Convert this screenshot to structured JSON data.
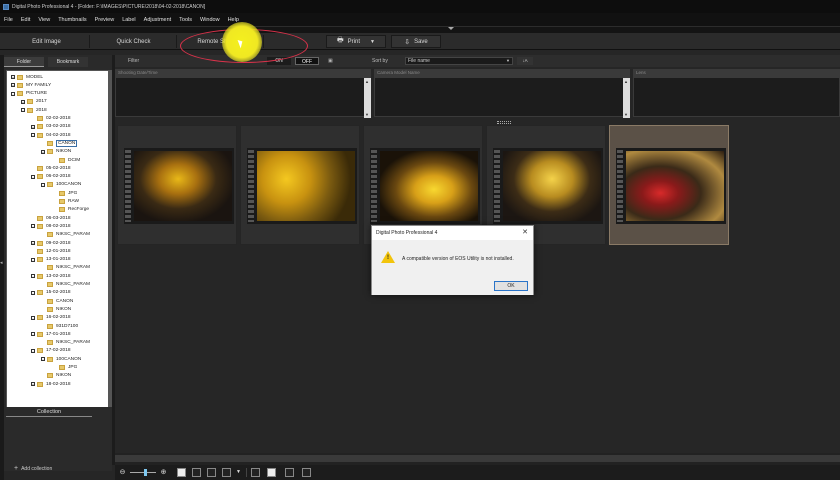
{
  "window": {
    "title": "Digital Photo Professional 4 - [Folder: F:\\IMAGES\\PICTURE\\2018\\04-02-2018\\CANON]"
  },
  "menu": [
    "File",
    "Edit",
    "View",
    "Thumbnails",
    "Preview",
    "Label",
    "Adjustment",
    "Tools",
    "Window",
    "Help"
  ],
  "toolbar": {
    "edit_image": "Edit Image",
    "quick_check": "Quick Check",
    "remote_shooting": "Remote Shooting",
    "print": "Print",
    "save": "Save"
  },
  "left_panel": {
    "tabs": [
      "Folder",
      "Bookmark"
    ],
    "tree": [
      {
        "label": "MODEL",
        "level": 1,
        "expander": "+"
      },
      {
        "label": "MY FAMILY",
        "level": 1,
        "expander": "+"
      },
      {
        "label": "PICTURE",
        "level": 1,
        "expander": "-"
      },
      {
        "label": "2017",
        "level": 2,
        "expander": "+"
      },
      {
        "label": "2018",
        "level": 2,
        "expander": "-"
      },
      {
        "label": "02-02-2018",
        "level": 3,
        "expander": ""
      },
      {
        "label": "03-02-2018",
        "level": 3,
        "expander": "+"
      },
      {
        "label": "04-02-2018",
        "level": 3,
        "expander": "-"
      },
      {
        "label": "CANON",
        "level": 4,
        "expander": "",
        "selected": true
      },
      {
        "label": "NIKON",
        "level": 4,
        "expander": "+"
      },
      {
        "label": "DCIM",
        "level": 5,
        "expander": ""
      },
      {
        "label": "05-02-2018",
        "level": 3,
        "expander": ""
      },
      {
        "label": "06-02-2018",
        "level": 3,
        "expander": "-"
      },
      {
        "label": "100CANON",
        "level": 4,
        "expander": "-"
      },
      {
        "label": "JPG",
        "level": 5,
        "expander": ""
      },
      {
        "label": "RAW",
        "level": 5,
        "expander": ""
      },
      {
        "label": "RecForge",
        "level": 5,
        "expander": ""
      },
      {
        "label": "06-03-2018",
        "level": 3,
        "expander": ""
      },
      {
        "label": "08-02-2018",
        "level": 3,
        "expander": "-"
      },
      {
        "label": "NIKSC_PARAM",
        "level": 4,
        "expander": ""
      },
      {
        "label": "09-02-2018",
        "level": 3,
        "expander": "+"
      },
      {
        "label": "12-01-2018",
        "level": 3,
        "expander": ""
      },
      {
        "label": "13-01-2018",
        "level": 3,
        "expander": "-"
      },
      {
        "label": "NIKSC_PARAM",
        "level": 4,
        "expander": ""
      },
      {
        "label": "13-02-2018",
        "level": 3,
        "expander": "-"
      },
      {
        "label": "NIKSC_PARAM",
        "level": 4,
        "expander": ""
      },
      {
        "label": "15-02-2018",
        "level": 3,
        "expander": "-"
      },
      {
        "label": "CANON",
        "level": 4,
        "expander": ""
      },
      {
        "label": "NIKON",
        "level": 4,
        "expander": ""
      },
      {
        "label": "16-02-2018",
        "level": 3,
        "expander": "-"
      },
      {
        "label": "931D7100",
        "level": 4,
        "expander": ""
      },
      {
        "label": "17-01-2018",
        "level": 3,
        "expander": "-"
      },
      {
        "label": "NIKSC_PARAM",
        "level": 4,
        "expander": ""
      },
      {
        "label": "17-02-2018",
        "level": 3,
        "expander": "-"
      },
      {
        "label": "100CANON",
        "level": 4,
        "expander": "-"
      },
      {
        "label": "JPG",
        "level": 5,
        "expander": ""
      },
      {
        "label": "NIKON",
        "level": 4,
        "expander": ""
      },
      {
        "label": "18-02-2018",
        "level": 3,
        "expander": "+"
      }
    ],
    "collection_title": "Collection",
    "add_collection": "Add collection"
  },
  "filter_bar": {
    "filter_label": "Filter",
    "on": "ON",
    "off": "OFF",
    "sort_by_label": "Sort by",
    "sort_value": "File name"
  },
  "filter_columns": [
    "Shooting Date/Time",
    "Camera Model Name",
    "Lens"
  ],
  "thumbnails": [
    {
      "name": "thumb-1",
      "photo": "p1",
      "selected": false
    },
    {
      "name": "thumb-2",
      "photo": "p2",
      "selected": false
    },
    {
      "name": "thumb-3",
      "photo": "p3",
      "selected": false
    },
    {
      "name": "thumb-4",
      "photo": "p4",
      "selected": false
    },
    {
      "name": "thumb-5",
      "photo": "p5",
      "selected": true
    }
  ],
  "dialog": {
    "title": "Digital Photo Professional 4",
    "message": "A compatible version of EOS Utility is not installed.",
    "ok": "OK"
  },
  "colors": {
    "annotation_ellipse": "#d8324a",
    "cursor_highlight": "#f4f01e",
    "selection_accent": "#3a6ea5"
  }
}
